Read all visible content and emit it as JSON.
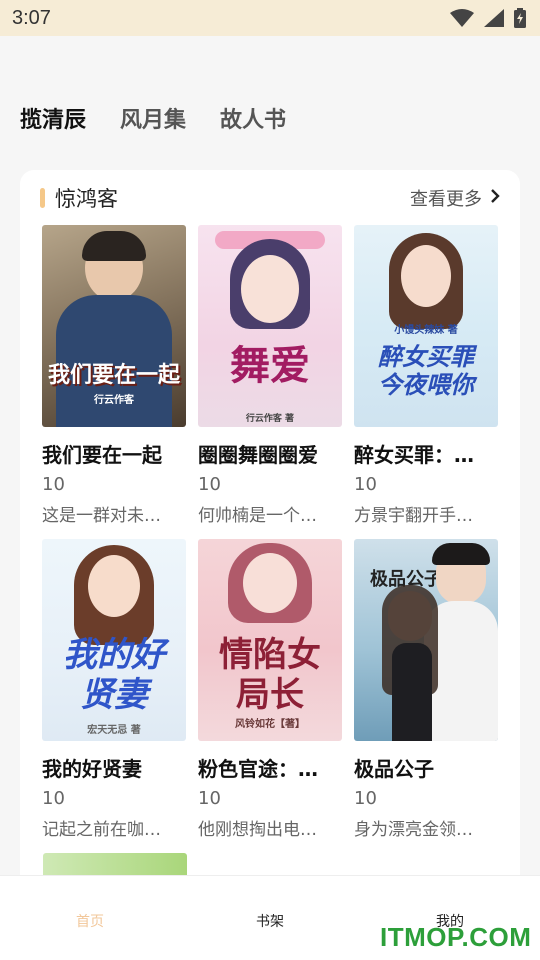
{
  "status_bar": {
    "time": "3:07"
  },
  "tabs": [
    {
      "label": "揽清辰",
      "active": true
    },
    {
      "label": "风月集",
      "active": false
    },
    {
      "label": "故人书",
      "active": false
    }
  ],
  "section": {
    "title": "惊鸿客",
    "more_label": "查看更多"
  },
  "books": [
    {
      "title": "我们要在一起",
      "score": "10",
      "desc": "这是一群对未…",
      "cover_title": "我们要在一起",
      "cover_author": "行云作客"
    },
    {
      "title": "圈圈舞圈圈爱",
      "score": "10",
      "desc": "何帅楠是一个…",
      "cover_title": "舞爱",
      "cover_author": "行云作客 著"
    },
    {
      "title": "醉女买罪：…",
      "score": "10",
      "desc": "方景宇翻开手…",
      "cover_title": "醉女买罪 今夜喂你",
      "cover_author": "小馒头辣妹 著"
    },
    {
      "title": "我的好贤妻",
      "score": "10",
      "desc": "记起之前在咖…",
      "cover_title": "我的好贤妻",
      "cover_author": "宏天无忌 著"
    },
    {
      "title": "粉色官途：…",
      "score": "10",
      "desc": "他刚想掏出电…",
      "cover_title": "情陷女局长",
      "cover_author": "风铃如花【著】"
    },
    {
      "title": "极品公子",
      "score": "10",
      "desc": "身为漂亮金领…",
      "cover_title": "极品公子",
      "cover_author": ""
    }
  ],
  "bottom_nav": [
    {
      "label": "首页",
      "active": true
    },
    {
      "label": "书架",
      "active": false
    },
    {
      "label": "我的",
      "active": false
    }
  ],
  "watermark": "ITMOP.COM",
  "colors": {
    "status_bg": "#f6ecd6",
    "accent": "#f5c889",
    "nav_active": "#f2c79a",
    "watermark": "#2d9f3a"
  }
}
